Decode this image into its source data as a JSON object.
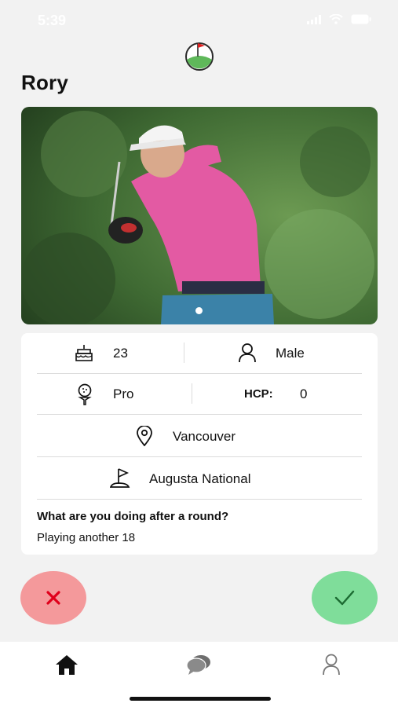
{
  "status_bar": {
    "time": "5:39"
  },
  "profile": {
    "name": "Rory",
    "photo_description_icon": "golfer-photo",
    "age": "23",
    "gender": "Male",
    "level": "Pro",
    "hcp_label": "HCP:",
    "hcp_value": "0",
    "location": "Vancouver",
    "home_course": "Augusta National",
    "question": "What are you doing after a round?",
    "answer": "Playing another 18"
  },
  "icons": {
    "logo": "golf-logo-icon",
    "age": "birthday-cake-icon",
    "gender": "person-icon",
    "level": "golf-ball-tee-icon",
    "location": "location-pin-icon",
    "course": "flag-icon",
    "reject": "x-icon",
    "accept": "check-icon",
    "tabs": [
      "home-icon",
      "chat-icon",
      "profile-icon"
    ]
  },
  "colors": {
    "reject_bg": "#f4999b",
    "reject_icon": "#e0001b",
    "accept_bg": "#7fdd9a",
    "accept_icon": "#1c6b32",
    "page_bg": "#f2f2f2"
  }
}
